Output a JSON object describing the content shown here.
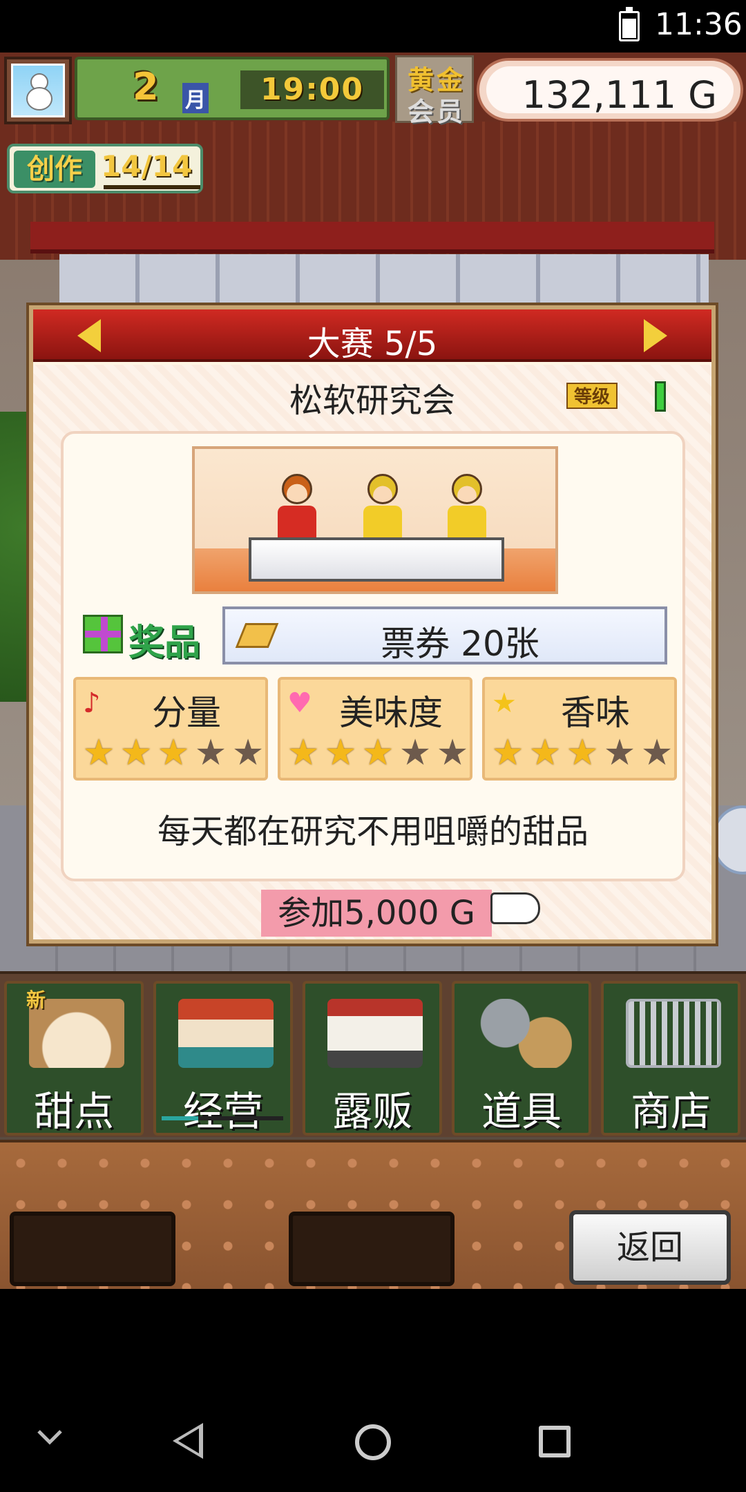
{
  "status_bar": {
    "time": "11:36"
  },
  "hud": {
    "month_number": "2",
    "month_unit": "月",
    "clock": "19:00",
    "membership_line1": "黄金",
    "membership_line2": "会员",
    "money": "132,111 G",
    "create_label": "创作",
    "create_count": "14/14"
  },
  "contest": {
    "title": "大赛 5/5",
    "team_name": "松软研究会",
    "grade_label": "等级",
    "prize_label": "奖品",
    "prize_value": "票券 20张",
    "stats": [
      {
        "name": "分量",
        "icon": "music-note-icon",
        "stars": 3,
        "max": 5
      },
      {
        "name": "美味度",
        "icon": "heart-icon",
        "stars": 3,
        "max": 5
      },
      {
        "name": "香味",
        "icon": "star-icon",
        "stars": 3,
        "max": 5
      }
    ],
    "description": "每天都在研究不用咀嚼的甜品",
    "join_label": "参加5,000 G"
  },
  "menu": {
    "new_badge": "新",
    "items": [
      {
        "label": "甜点"
      },
      {
        "label": "经营"
      },
      {
        "label": "露贩"
      },
      {
        "label": "道具"
      },
      {
        "label": "商店"
      }
    ]
  },
  "bottom": {
    "back_label": "返回"
  },
  "colors": {
    "header_red": "#c0221c",
    "accent_gold": "#f3cf3c",
    "join_pink": "#f39bab",
    "menu_green": "#2e4f2a"
  }
}
